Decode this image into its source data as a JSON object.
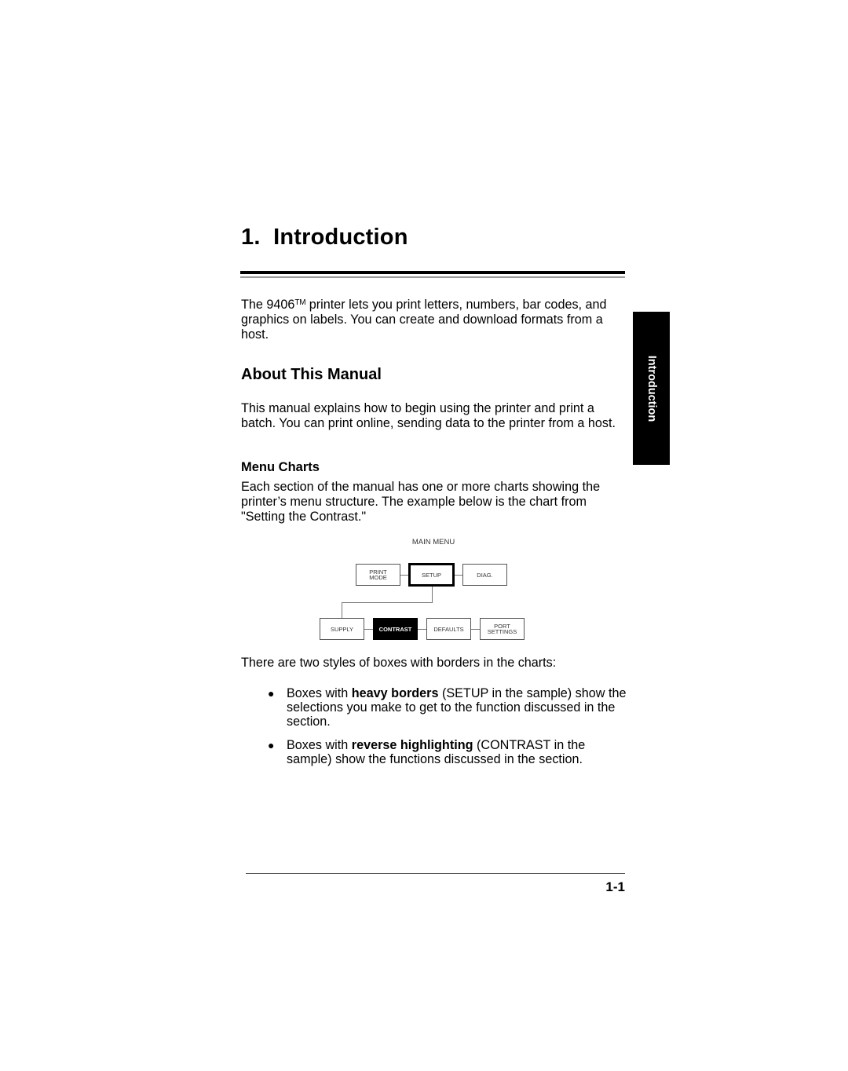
{
  "chapter": {
    "title": "1.  Introduction"
  },
  "intro": {
    "text_before_tm": "The 9406",
    "tm": "TM",
    "text_after_tm": " printer lets you print letters, numbers, bar codes, and graphics on labels.  You can create and download formats from a host."
  },
  "side_tab": {
    "label": "Introduction"
  },
  "about": {
    "heading": "About This Manual",
    "text": "This manual explains how to begin using the printer and print a batch.  You can print online, sending data to the printer from a host."
  },
  "menu_charts": {
    "heading": "Menu Charts",
    "text": "Each section of the manual has one or more charts showing the printer’s menu structure.  The example below is the chart from \"Setting the Contrast.\""
  },
  "menu_chart": {
    "title": "MAIN MENU",
    "top_row": [
      {
        "label_line1": "PRINT",
        "label_line2": "MODE",
        "style": "normal"
      },
      {
        "label_line1": "SETUP",
        "label_line2": "",
        "style": "heavy"
      },
      {
        "label_line1": "DIAG.",
        "label_line2": "",
        "style": "normal"
      }
    ],
    "bottom_row": [
      {
        "label_line1": "SUPPLY",
        "label_line2": "",
        "style": "normal"
      },
      {
        "label_line1": "CONTRAST",
        "label_line2": "",
        "style": "reverse"
      },
      {
        "label_line1": "DEFAULTS",
        "label_line2": "",
        "style": "normal"
      },
      {
        "label_line1": "PORT",
        "label_line2": "SETTINGS",
        "style": "normal"
      }
    ]
  },
  "box_styles": {
    "intro": "There are two styles of boxes with borders in the charts:",
    "bullets": [
      {
        "prefix": "Boxes with ",
        "bold": "heavy borders",
        "suffix": " (SETUP in the sample) show the selections you make to get to the function discussed in the section."
      },
      {
        "prefix": "Boxes with ",
        "bold": "reverse highlighting",
        "suffix": " (CONTRAST in the sample) show the functions discussed in the section."
      }
    ],
    "bullet_glyph": "●"
  },
  "footer": {
    "page_number": "1-1"
  }
}
